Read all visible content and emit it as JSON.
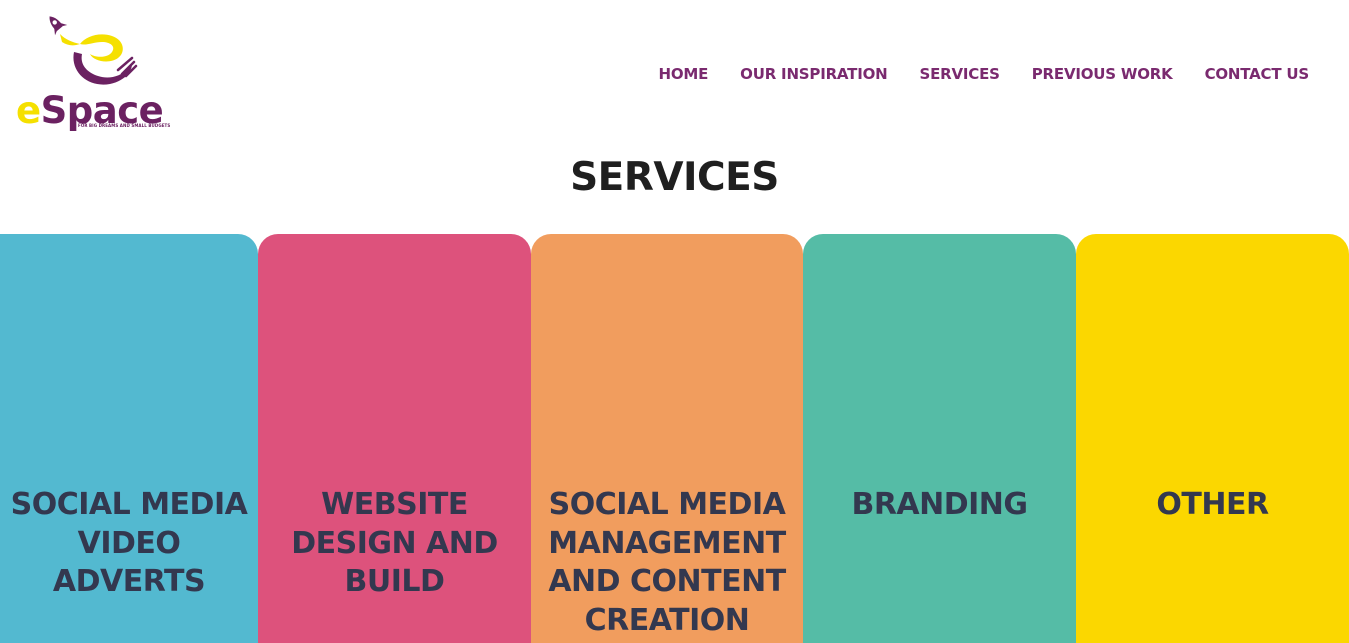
{
  "logo": {
    "word_prefix": "e",
    "word_rest": "Space",
    "tagline": "FOR BIG DREAMS AND SMALL BUDGETS",
    "icon": "rocket-loop-icon",
    "colors": {
      "yellow": "#f5e000",
      "purple": "#6b2161"
    }
  },
  "nav": {
    "items": [
      {
        "label": "HOME"
      },
      {
        "label": "OUR INSPIRATION"
      },
      {
        "label": "SERVICES"
      },
      {
        "label": "PREVIOUS WORK"
      },
      {
        "label": "CONTACT US"
      }
    ],
    "color": "#7a2a6f"
  },
  "services": {
    "title": "SERVICES",
    "cards": [
      {
        "label": "SOCIAL MEDIA VIDEO ADVERTS",
        "color": "#53b9d0"
      },
      {
        "label": "WEBSITE DESIGN AND BUILD",
        "color": "#dd527c"
      },
      {
        "label": "SOCIAL MEDIA MANAGEMENT AND CONTENT CREATION",
        "color": "#f19d5e"
      },
      {
        "label": "BRANDING",
        "color": "#55bca6"
      },
      {
        "label": "OTHER",
        "color": "#fbd700"
      }
    ]
  }
}
